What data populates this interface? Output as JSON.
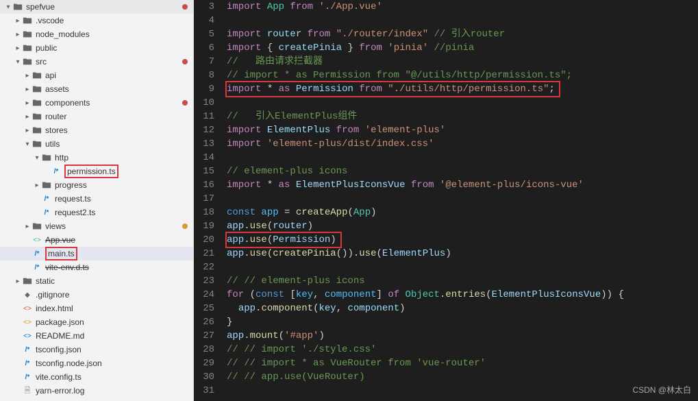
{
  "tree": {
    "root": "spefvue",
    "items": [
      {
        "d": 0,
        "ch": "▾",
        "icon": "folder",
        "label": "spefvue",
        "dot": "red"
      },
      {
        "d": 1,
        "ch": "▸",
        "icon": "folder",
        "label": ".vscode"
      },
      {
        "d": 1,
        "ch": "▸",
        "icon": "folder",
        "label": "node_modules"
      },
      {
        "d": 1,
        "ch": "▸",
        "icon": "folder",
        "label": "public"
      },
      {
        "d": 1,
        "ch": "▾",
        "icon": "folder",
        "label": "src",
        "dot": "red"
      },
      {
        "d": 2,
        "ch": "▸",
        "icon": "folder",
        "label": "api"
      },
      {
        "d": 2,
        "ch": "▸",
        "icon": "folder",
        "label": "assets"
      },
      {
        "d": 2,
        "ch": "▸",
        "icon": "folder",
        "label": "components",
        "dot": "red"
      },
      {
        "d": 2,
        "ch": "▸",
        "icon": "folder",
        "label": "router"
      },
      {
        "d": 2,
        "ch": "▸",
        "icon": "folder",
        "label": "stores"
      },
      {
        "d": 2,
        "ch": "▾",
        "icon": "folder",
        "label": "utils"
      },
      {
        "d": 3,
        "ch": "▾",
        "icon": "folder",
        "label": "http"
      },
      {
        "d": 4,
        "ch": "",
        "icon": "file-ts",
        "label": "permission.ts",
        "hl": true
      },
      {
        "d": 3,
        "ch": "▸",
        "icon": "folder",
        "label": "progress"
      },
      {
        "d": 3,
        "ch": "",
        "icon": "file-ts",
        "label": "request.ts"
      },
      {
        "d": 3,
        "ch": "",
        "icon": "file-ts",
        "label": "request2.ts"
      },
      {
        "d": 2,
        "ch": "▸",
        "icon": "folder",
        "label": "views",
        "dot": "orange"
      },
      {
        "d": 2,
        "ch": "",
        "icon": "file-vue",
        "label": "App.vue",
        "strike": true
      },
      {
        "d": 2,
        "ch": "",
        "icon": "file-ts",
        "label": "main.ts",
        "hl": true,
        "active": true
      },
      {
        "d": 2,
        "ch": "",
        "icon": "file-ts",
        "label": "vite-env.d.ts",
        "strike": true
      },
      {
        "d": 1,
        "ch": "▸",
        "icon": "folder",
        "label": "static"
      },
      {
        "d": 1,
        "ch": "",
        "icon": "file-gitignore",
        "label": ".gitignore"
      },
      {
        "d": 1,
        "ch": "",
        "icon": "file-html",
        "label": "index.html"
      },
      {
        "d": 1,
        "ch": "",
        "icon": "file-json",
        "label": "package.json"
      },
      {
        "d": 1,
        "ch": "",
        "icon": "file-md",
        "label": "README.md"
      },
      {
        "d": 1,
        "ch": "",
        "icon": "file-ts",
        "label": "tsconfig.json"
      },
      {
        "d": 1,
        "ch": "",
        "icon": "file-ts",
        "label": "tsconfig.node.json"
      },
      {
        "d": 1,
        "ch": "",
        "icon": "file-ts",
        "label": "vite.config.ts"
      },
      {
        "d": 1,
        "ch": "",
        "icon": "file-log",
        "label": "yarn-error.log"
      }
    ]
  },
  "code": {
    "start": 3,
    "lines": [
      {
        "t": [
          [
            "kw",
            "import"
          ],
          [
            "pun",
            " "
          ],
          [
            "cls",
            "App"
          ],
          [
            "pun",
            " "
          ],
          [
            "kw",
            "from"
          ],
          [
            "pun",
            " "
          ],
          [
            "str",
            "'./App.vue'"
          ]
        ]
      },
      {
        "t": []
      },
      {
        "t": [
          [
            "kw",
            "import"
          ],
          [
            "pun",
            " "
          ],
          [
            "var",
            "router"
          ],
          [
            "pun",
            " "
          ],
          [
            "kw",
            "from"
          ],
          [
            "pun",
            " "
          ],
          [
            "str",
            "\"./router/index\""
          ],
          [
            "pun",
            " "
          ],
          [
            "cm",
            "// 引入router"
          ]
        ]
      },
      {
        "t": [
          [
            "kw",
            "import"
          ],
          [
            "pun",
            " { "
          ],
          [
            "var",
            "createPinia"
          ],
          [
            "pun",
            " } "
          ],
          [
            "kw",
            "from"
          ],
          [
            "pun",
            " "
          ],
          [
            "str",
            "'pinia'"
          ],
          [
            "pun",
            " "
          ],
          [
            "cm",
            "//pinia"
          ]
        ]
      },
      {
        "t": [
          [
            "cm",
            "//   路由请求拦截器"
          ]
        ]
      },
      {
        "t": [
          [
            "cm",
            "// import * as Permission from \"@/utils/http/permission.ts\";"
          ]
        ]
      },
      {
        "hl": true,
        "t": [
          [
            "kw",
            "import"
          ],
          [
            "pun",
            " * "
          ],
          [
            "kw",
            "as"
          ],
          [
            "pun",
            " "
          ],
          [
            "var",
            "Permission"
          ],
          [
            "pun",
            " "
          ],
          [
            "kw",
            "from"
          ],
          [
            "pun",
            " "
          ],
          [
            "str",
            "\"./utils/http/permission.ts\""
          ],
          [
            "pun",
            ";"
          ]
        ]
      },
      {
        "t": []
      },
      {
        "t": [
          [
            "cm",
            "//   引入ElementPlus组件"
          ]
        ]
      },
      {
        "t": [
          [
            "kw",
            "import"
          ],
          [
            "pun",
            " "
          ],
          [
            "var",
            "ElementPlus"
          ],
          [
            "pun",
            " "
          ],
          [
            "kw",
            "from"
          ],
          [
            "pun",
            " "
          ],
          [
            "str",
            "'element-plus'"
          ]
        ]
      },
      {
        "t": [
          [
            "kw",
            "import"
          ],
          [
            "pun",
            " "
          ],
          [
            "str",
            "'element-plus/dist/index.css'"
          ]
        ]
      },
      {
        "t": []
      },
      {
        "t": [
          [
            "cm",
            "// element-plus icons"
          ]
        ]
      },
      {
        "t": [
          [
            "kw",
            "import"
          ],
          [
            "pun",
            " * "
          ],
          [
            "kw",
            "as"
          ],
          [
            "pun",
            " "
          ],
          [
            "var",
            "ElementPlusIconsVue"
          ],
          [
            "pun",
            " "
          ],
          [
            "kw",
            "from"
          ],
          [
            "pun",
            " "
          ],
          [
            "str",
            "'@element-plus/icons-vue'"
          ]
        ]
      },
      {
        "t": []
      },
      {
        "t": [
          [
            "kw2",
            "const"
          ],
          [
            "pun",
            " "
          ],
          [
            "const",
            "app"
          ],
          [
            "pun",
            " = "
          ],
          [
            "fn",
            "createApp"
          ],
          [
            "pun",
            "("
          ],
          [
            "cls",
            "App"
          ],
          [
            "pun",
            ")"
          ]
        ]
      },
      {
        "t": [
          [
            "var",
            "app"
          ],
          [
            "pun",
            "."
          ],
          [
            "fn",
            "use"
          ],
          [
            "pun",
            "("
          ],
          [
            "var",
            "router"
          ],
          [
            "pun",
            ")"
          ]
        ]
      },
      {
        "hl": true,
        "t": [
          [
            "var",
            "app"
          ],
          [
            "pun",
            "."
          ],
          [
            "fn",
            "use"
          ],
          [
            "pun",
            "("
          ],
          [
            "var",
            "Permission"
          ],
          [
            "pun",
            ")"
          ]
        ]
      },
      {
        "t": [
          [
            "var",
            "app"
          ],
          [
            "pun",
            "."
          ],
          [
            "fn",
            "use"
          ],
          [
            "pun",
            "("
          ],
          [
            "fn",
            "createPinia"
          ],
          [
            "pun",
            "())."
          ],
          [
            "fn",
            "use"
          ],
          [
            "pun",
            "("
          ],
          [
            "var",
            "ElementPlus"
          ],
          [
            "pun",
            ")"
          ]
        ]
      },
      {
        "t": []
      },
      {
        "t": [
          [
            "cm",
            "// // element-plus icons"
          ]
        ]
      },
      {
        "t": [
          [
            "kw",
            "for"
          ],
          [
            "pun",
            " ("
          ],
          [
            "kw2",
            "const"
          ],
          [
            "pun",
            " ["
          ],
          [
            "const",
            "key"
          ],
          [
            "pun",
            ", "
          ],
          [
            "const",
            "component"
          ],
          [
            "pun",
            "] "
          ],
          [
            "kw",
            "of"
          ],
          [
            "pun",
            " "
          ],
          [
            "cls",
            "Object"
          ],
          [
            "pun",
            "."
          ],
          [
            "fn",
            "entries"
          ],
          [
            "pun",
            "("
          ],
          [
            "var",
            "ElementPlusIconsVue"
          ],
          [
            "pun",
            ")) {"
          ]
        ]
      },
      {
        "t": [
          [
            "pun",
            "  "
          ],
          [
            "var",
            "app"
          ],
          [
            "pun",
            "."
          ],
          [
            "fn",
            "component"
          ],
          [
            "pun",
            "("
          ],
          [
            "var",
            "key"
          ],
          [
            "pun",
            ", "
          ],
          [
            "var",
            "component"
          ],
          [
            "pun",
            ")"
          ]
        ]
      },
      {
        "t": [
          [
            "pun",
            "}"
          ]
        ]
      },
      {
        "t": [
          [
            "var",
            "app"
          ],
          [
            "pun",
            "."
          ],
          [
            "fn",
            "mount"
          ],
          [
            "pun",
            "("
          ],
          [
            "str",
            "'#app'"
          ],
          [
            "pun",
            ")"
          ]
        ]
      },
      {
        "t": [
          [
            "cm",
            "// // import './style.css'"
          ]
        ]
      },
      {
        "t": [
          [
            "cm",
            "// // import * as VueRouter from 'vue-router'"
          ]
        ]
      },
      {
        "t": [
          [
            "cm",
            "// // app.use(VueRouter)"
          ]
        ]
      },
      {
        "t": []
      }
    ]
  },
  "watermark": "CSDN @林太白"
}
